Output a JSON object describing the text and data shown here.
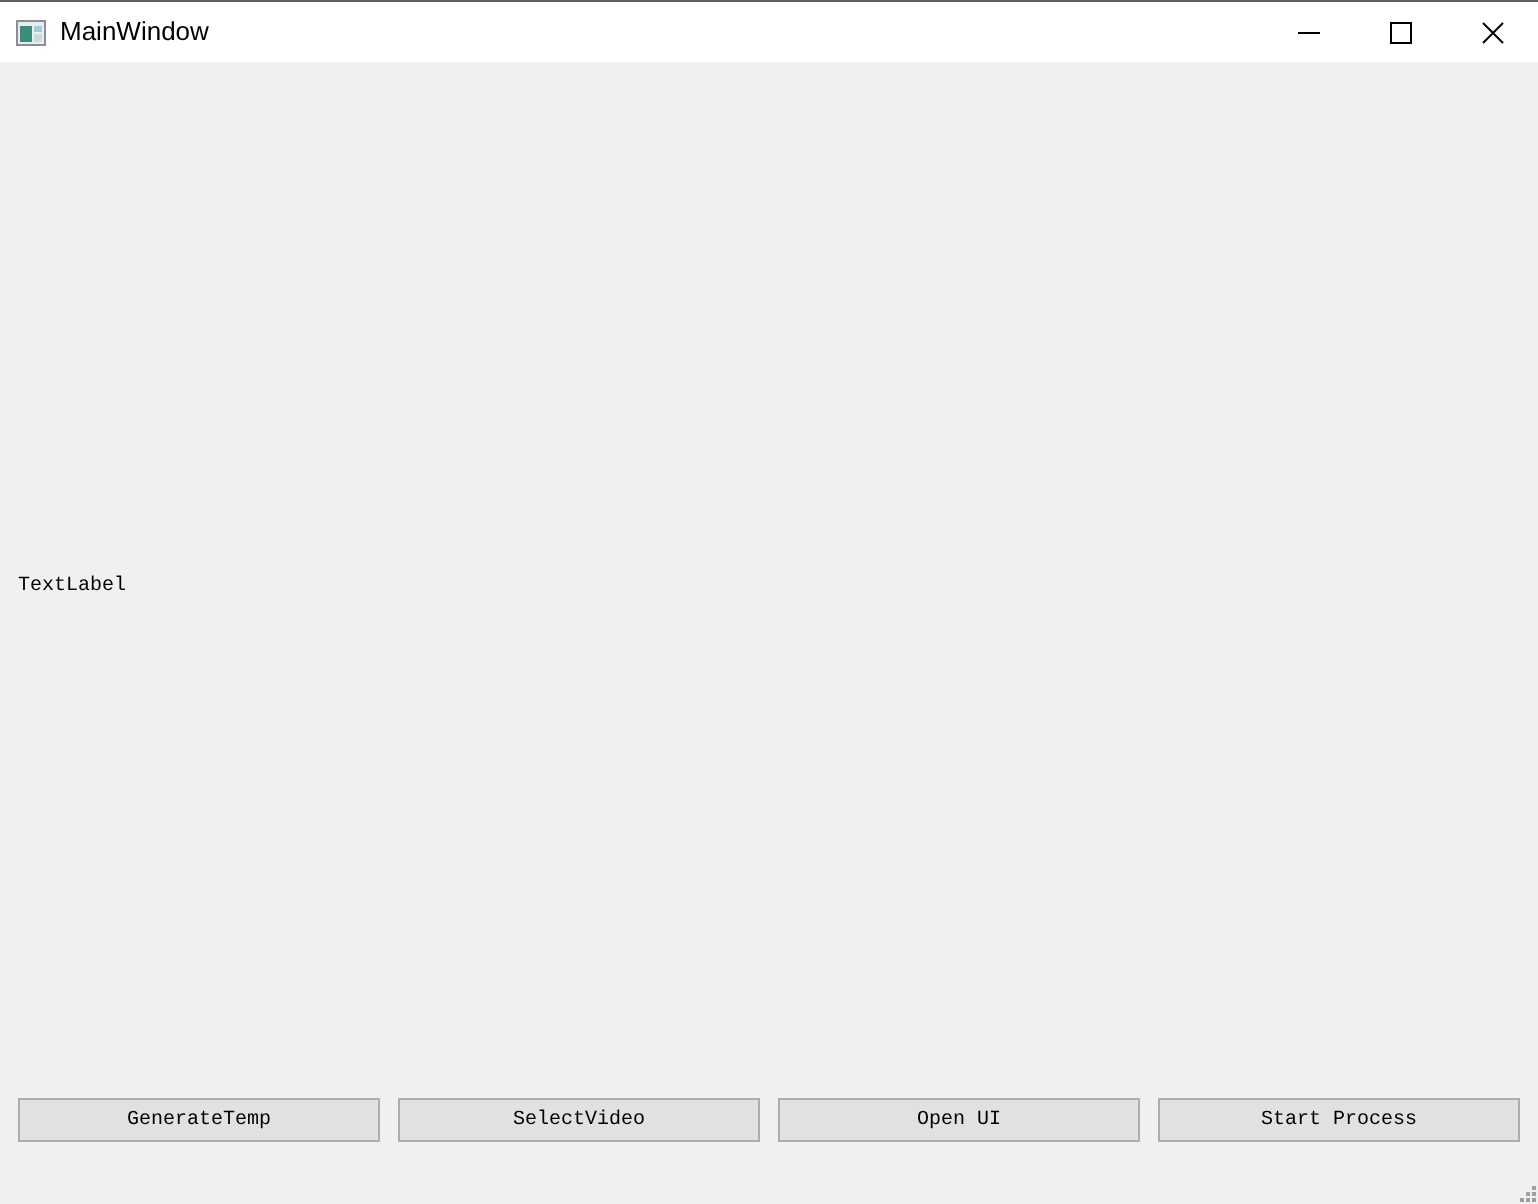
{
  "window": {
    "title": "MainWindow"
  },
  "label": {
    "text": "TextLabel"
  },
  "buttons": [
    "GenerateTemp",
    "SelectVideo",
    "Open UI",
    "Start Process"
  ]
}
